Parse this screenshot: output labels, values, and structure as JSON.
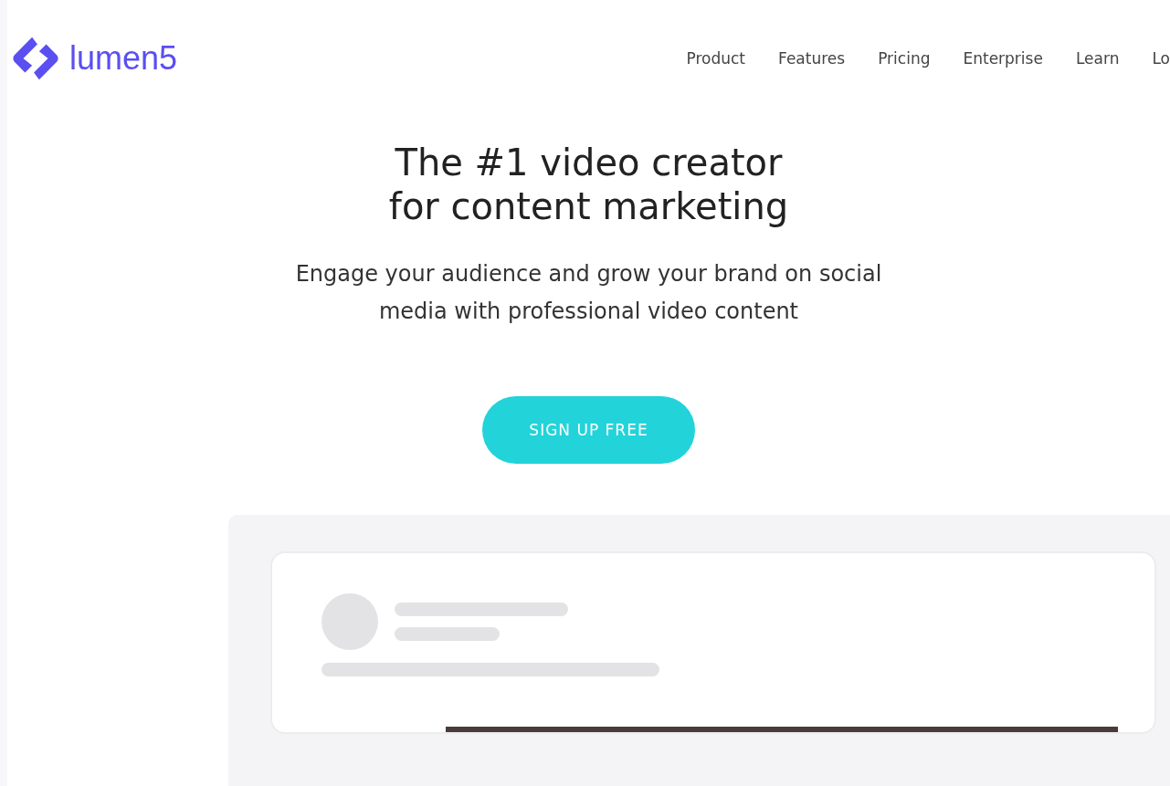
{
  "logo": {
    "text": "lumen5"
  },
  "nav": [
    {
      "label": "Product"
    },
    {
      "label": "Features"
    },
    {
      "label": "Pricing"
    },
    {
      "label": "Enterprise"
    },
    {
      "label": "Learn"
    },
    {
      "label": "Lo"
    }
  ],
  "hero": {
    "title_lines": [
      "The #1 video creator",
      "for content marketing"
    ],
    "subtitle_lines": [
      "Engage your audience and grow your brand on social",
      "media with professional video content"
    ],
    "cta": "SIGN UP FREE"
  }
}
